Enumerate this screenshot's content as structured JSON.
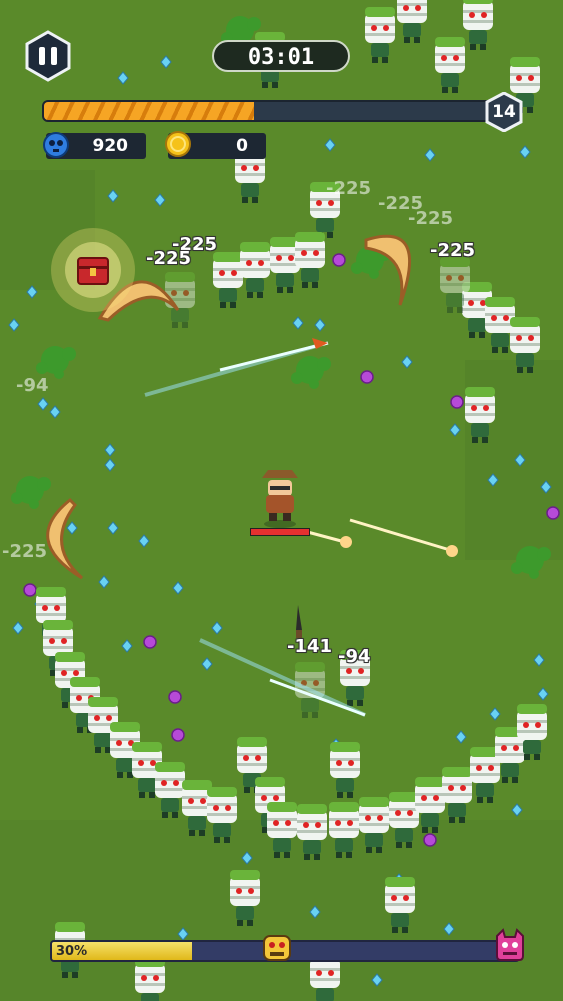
{
  "hud": {
    "timer": "03:01",
    "xp_fraction": 0.45,
    "level": "14",
    "kills": "920",
    "gold": "0",
    "wave_percent_label": "30%",
    "wave_progress": 0.3
  },
  "damage_numbers": [
    {
      "text": "-225",
      "faded": true
    },
    {
      "text": "-225",
      "faded": true
    },
    {
      "text": "-225",
      "faded": true
    },
    {
      "text": "-225",
      "faded": false
    },
    {
      "text": "-225",
      "faded": false
    },
    {
      "text": "-225",
      "faded": false
    },
    {
      "text": "-141",
      "faded": false
    },
    {
      "text": "-94",
      "faded": false
    },
    {
      "text": "-225",
      "faded": true
    },
    {
      "text": "-94",
      "faded": true
    }
  ],
  "icons": {
    "pause": "pause-icon",
    "kills": "skull-icon",
    "gold": "coin-icon",
    "midboss": "yellow-monster-icon",
    "boss": "pink-demon-icon",
    "chest": "treasure-chest-icon"
  },
  "colors": {
    "grass": "#5a8a2a",
    "xp": "#f6a524",
    "wave": "#f1d23a",
    "player_hp": "#e53030"
  }
}
